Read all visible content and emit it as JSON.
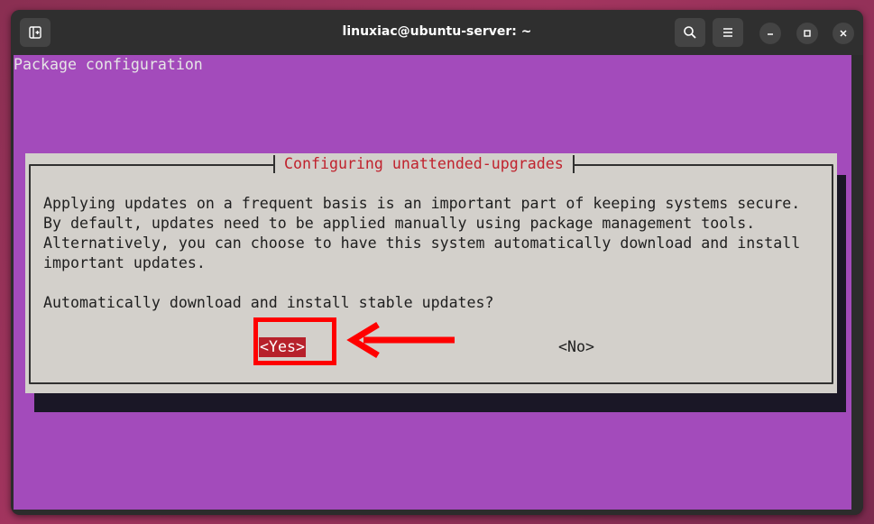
{
  "window": {
    "title": "linuxiac@ubuntu-server: ~"
  },
  "titlebar": {
    "new_tab_icon": "new-tab-icon",
    "search_icon": "search-icon",
    "menu_icon": "hamburger-menu-icon",
    "minimize_icon": "minimize-icon",
    "maximize_icon": "maximize-icon",
    "close_icon": "close-icon"
  },
  "terminal": {
    "header": "Package configuration",
    "background_color": "#a34bbb"
  },
  "dialog": {
    "title": "Configuring unattended-upgrades",
    "lines": [
      "Applying updates on a frequent basis is an important part of keeping systems secure.",
      "By default, updates need to be applied manually using package management tools.",
      "Alternatively, you can choose to have this system automatically download and install",
      "important updates."
    ],
    "question": "Automatically download and install stable updates?",
    "yes_label": "<Yes>",
    "no_label": "<No>",
    "selected": "<Yes>"
  },
  "annotation": {
    "color": "#ff0000",
    "target": "<Yes>"
  }
}
